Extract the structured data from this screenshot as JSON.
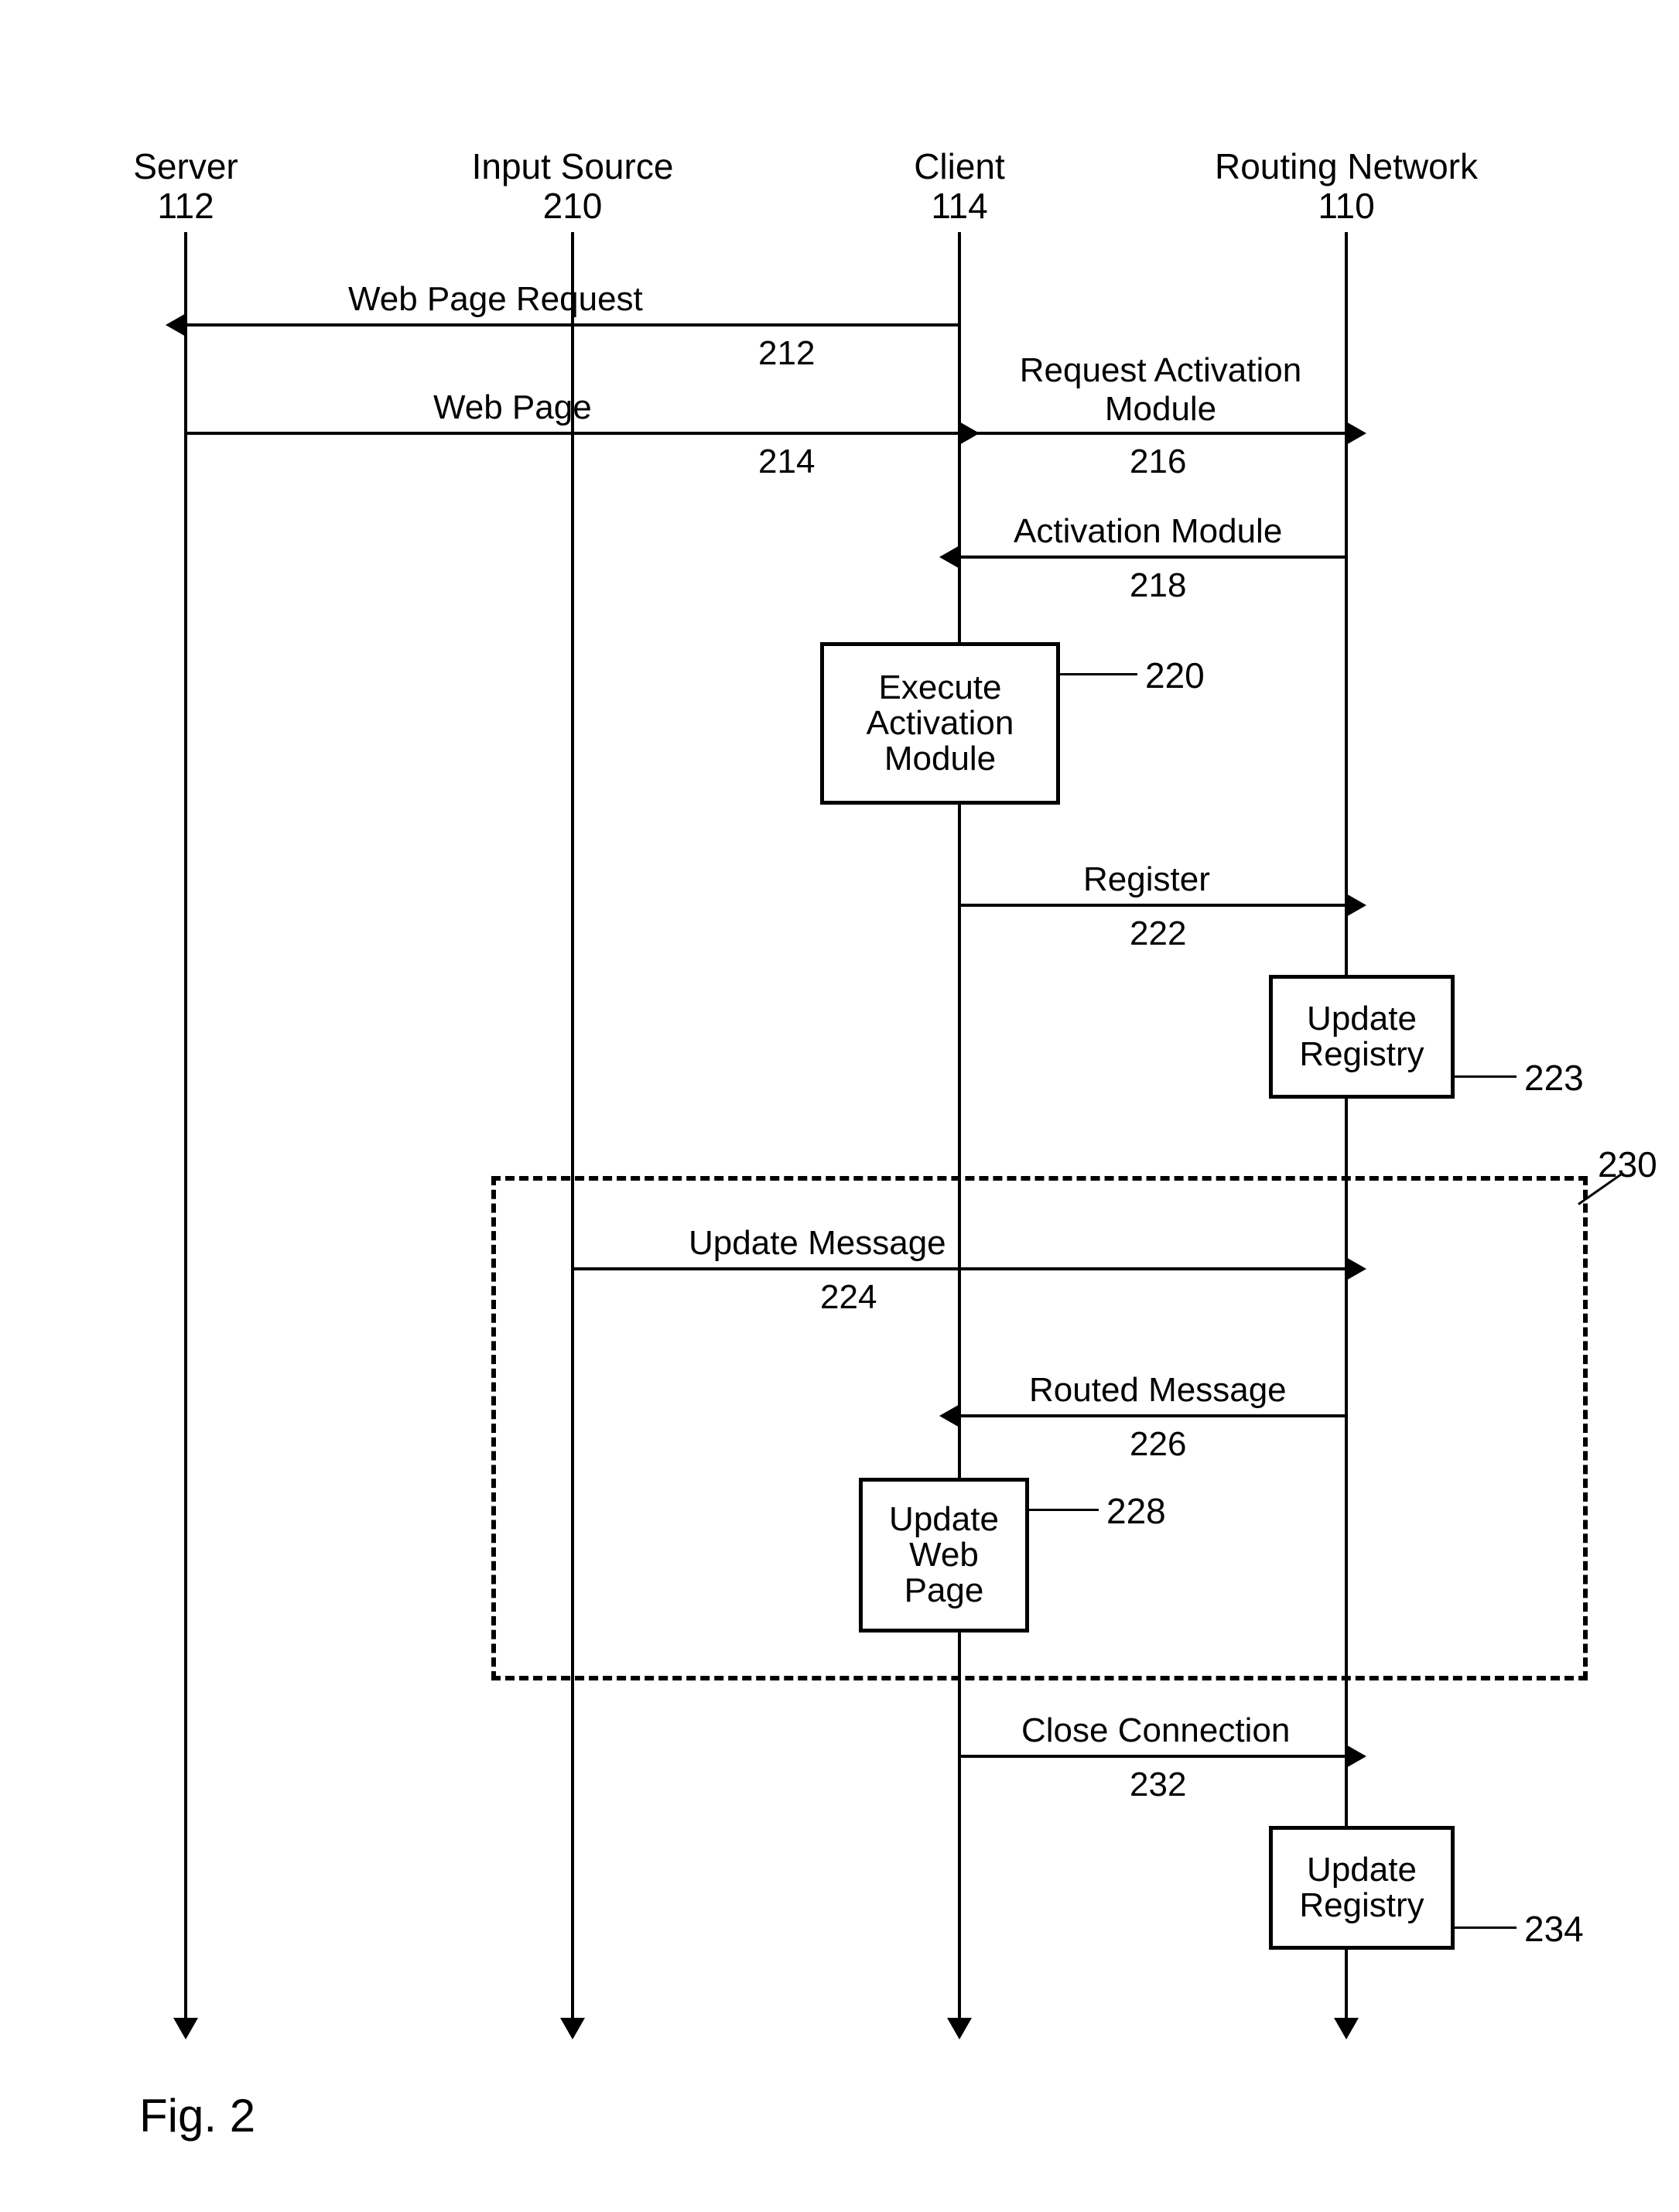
{
  "lifelines": {
    "server": {
      "label": "Server",
      "ref": "112"
    },
    "input": {
      "label": "Input Source",
      "ref": "210"
    },
    "client": {
      "label": "Client",
      "ref": "114"
    },
    "routing": {
      "label": "Routing Network",
      "ref": "110"
    }
  },
  "messages": {
    "m212": {
      "label": "Web Page Request",
      "ref": "212"
    },
    "m214": {
      "label": "Web Page",
      "ref": "214"
    },
    "m216": {
      "label": "Request Activation Module",
      "ref": "216"
    },
    "m218": {
      "label": "Activation Module",
      "ref": "218"
    },
    "m222": {
      "label": "Register",
      "ref": "222"
    },
    "m224": {
      "label": "Update Message",
      "ref": "224"
    },
    "m226": {
      "label": "Routed Message",
      "ref": "226"
    },
    "m232": {
      "label": "Close Connection",
      "ref": "232"
    }
  },
  "boxes": {
    "b220": {
      "label": "Execute Activation Module",
      "ref": "220"
    },
    "b223": {
      "label": "Update Registry",
      "ref": "223"
    },
    "b228": {
      "label": "Update Web Page",
      "ref": "228"
    },
    "b234": {
      "label": "Update Registry",
      "ref": "234"
    }
  },
  "groups": {
    "g230": {
      "ref": "230"
    }
  },
  "figure": "Fig. 2",
  "chart_data": {
    "type": "sequence-diagram",
    "participants": [
      {
        "id": "server",
        "name": "Server",
        "ref": "112"
      },
      {
        "id": "input",
        "name": "Input Source",
        "ref": "210"
      },
      {
        "id": "client",
        "name": "Client",
        "ref": "114"
      },
      {
        "id": "routing",
        "name": "Routing Network",
        "ref": "110"
      }
    ],
    "events": [
      {
        "ref": "212",
        "from": "client",
        "to": "server",
        "label": "Web Page Request"
      },
      {
        "ref": "214",
        "from": "server",
        "to": "client",
        "label": "Web Page"
      },
      {
        "ref": "216",
        "from": "client",
        "to": "routing",
        "label": "Request Activation Module"
      },
      {
        "ref": "218",
        "from": "routing",
        "to": "client",
        "label": "Activation Module"
      },
      {
        "ref": "220",
        "at": "client",
        "type": "self",
        "label": "Execute Activation Module"
      },
      {
        "ref": "222",
        "from": "client",
        "to": "routing",
        "label": "Register"
      },
      {
        "ref": "223",
        "at": "routing",
        "type": "self",
        "label": "Update Registry"
      },
      {
        "ref": "224",
        "from": "input",
        "to": "routing",
        "label": "Update Message",
        "group": "230"
      },
      {
        "ref": "226",
        "from": "routing",
        "to": "client",
        "label": "Routed Message",
        "group": "230"
      },
      {
        "ref": "228",
        "at": "client",
        "type": "self",
        "label": "Update Web Page",
        "group": "230"
      },
      {
        "ref": "232",
        "from": "client",
        "to": "routing",
        "label": "Close Connection"
      },
      {
        "ref": "234",
        "at": "routing",
        "type": "self",
        "label": "Update Registry"
      }
    ],
    "groups": [
      {
        "ref": "230",
        "members": [
          "224",
          "226",
          "228"
        ]
      }
    ]
  }
}
